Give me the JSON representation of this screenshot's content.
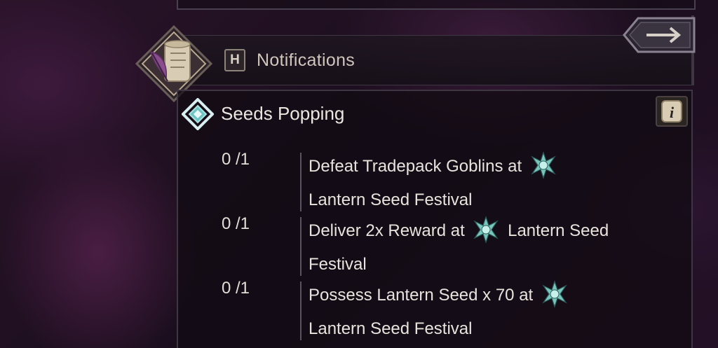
{
  "header": {
    "hotkey": "H",
    "title": "Notifications"
  },
  "quest": {
    "title": "Seeds Popping",
    "objectives": [
      {
        "count": "0 /1",
        "text_before": "Defeat Tradepack Goblins at",
        "text_after": "Lantern Seed Festival"
      },
      {
        "count": "0 /1",
        "text_before": "Deliver 2x Reward at",
        "text_after": "Lantern Seed Festival"
      },
      {
        "count": "0 /1",
        "text_before": "Possess Lantern Seed x 70 at",
        "text_after": "Lantern Seed Festival"
      }
    ]
  },
  "icons": {
    "badge": "scroll-quill-icon",
    "tab": "arrow-right-icon",
    "quest": "diamond-quest-icon",
    "info": "info-scroll-icon",
    "location": "festival-location-icon"
  },
  "colors": {
    "accent": "#6fc5c2",
    "text": "#e8e3dc",
    "border": "#3e3643"
  }
}
